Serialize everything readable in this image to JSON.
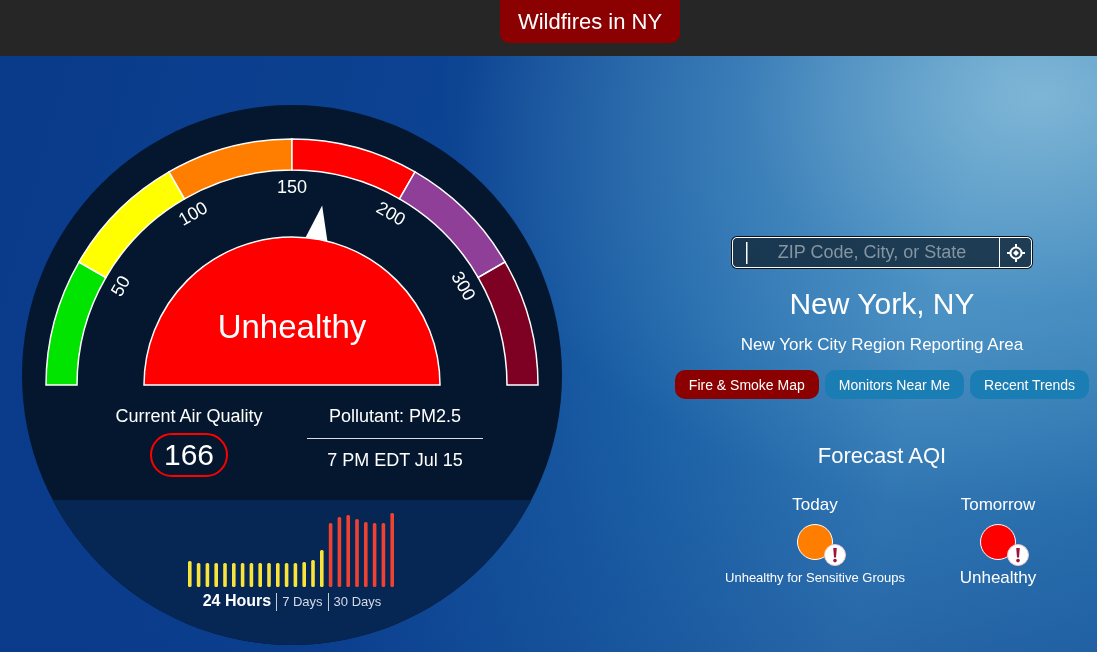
{
  "banner": {
    "label": "Wildfires in NY"
  },
  "gauge": {
    "segments": [
      {
        "color": "#00e400"
      },
      {
        "color": "#ffff00"
      },
      {
        "color": "#ff7e00"
      },
      {
        "color": "#ff0000"
      },
      {
        "color": "#8f3f97"
      },
      {
        "color": "#7e0023"
      }
    ],
    "tick_labels": [
      "50",
      "100",
      "150",
      "200",
      "300"
    ],
    "level": 0.553,
    "category": {
      "label": "Unhealthy",
      "color": "#ff0000"
    }
  },
  "current": {
    "label": "Current Air Quality",
    "value": "166",
    "pollutant": "Pollutant: PM2.5",
    "time": "7 PM EDT Jul 15"
  },
  "history": {
    "range_tabs": [
      {
        "label": "24 Hours",
        "selected": true
      },
      {
        "label": "7 Days",
        "selected": false
      },
      {
        "label": "30 Days",
        "selected": false
      }
    ]
  },
  "search": {
    "placeholder": "ZIP Code, City, or State"
  },
  "location": {
    "name": "New York, NY",
    "area": "New York City Region Reporting Area"
  },
  "buttons": [
    {
      "label": "Fire & Smoke Map",
      "color": "#8b0000"
    },
    {
      "label": "Monitors Near Me",
      "color": "#1a7db3"
    },
    {
      "label": "Recent Trends",
      "color": "#1a7db3"
    }
  ],
  "forecast": {
    "title": "Forecast AQI",
    "days": [
      {
        "day": "Today",
        "color": "#ff7e00",
        "category": "Unhealthy for Sensitive Groups"
      },
      {
        "day": "Tomorrow",
        "color": "#ff0000",
        "category": "Unhealthy"
      }
    ]
  }
}
